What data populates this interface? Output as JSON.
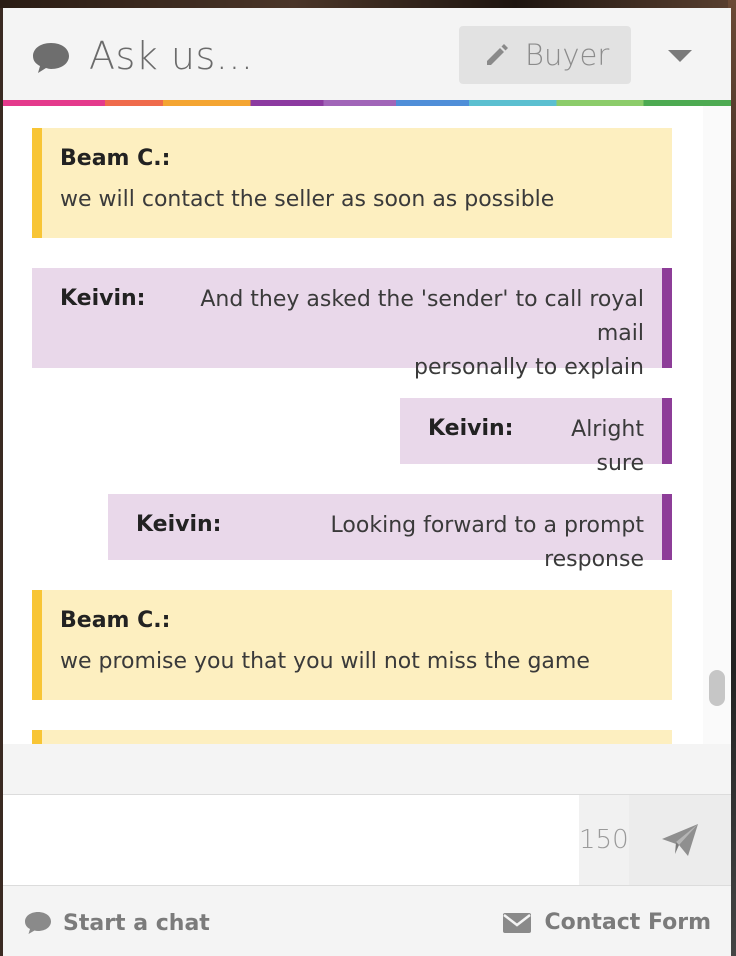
{
  "header": {
    "title": "Ask us...",
    "role_button_label": "Buyer",
    "chat_icon": "chat-bubble-icon",
    "role_icon": "pencil-icon",
    "dropdown_icon": "caret-down-icon"
  },
  "messages": [
    {
      "type": "agent",
      "name": "Beam C.:",
      "text": "we will contact the seller as soon as possible"
    },
    {
      "type": "user",
      "name": "Keivin:",
      "text_line1": "And they asked the 'sender' to call royal mail",
      "text_line2": "personally to explain"
    },
    {
      "type": "user",
      "name": "Keivin:",
      "text": "Alright sure"
    },
    {
      "type": "user",
      "name": "Keivin:",
      "text": "Looking forward to a prompt response"
    },
    {
      "type": "agent",
      "name": "Beam C.:",
      "text": "we promise you that you will not miss the game"
    }
  ],
  "composer": {
    "value": "",
    "char_count": "150",
    "send_icon": "paper-plane-icon"
  },
  "footer": {
    "start_chat_label": "Start a chat",
    "start_chat_icon": "chat-bubble-icon",
    "contact_form_label": "Contact Form",
    "contact_form_icon": "envelope-icon"
  },
  "colors": {
    "agent_bg": "#fdefc0",
    "agent_accent": "#f8c535",
    "user_bg": "#e9d8ea",
    "user_accent": "#8d3d98"
  }
}
